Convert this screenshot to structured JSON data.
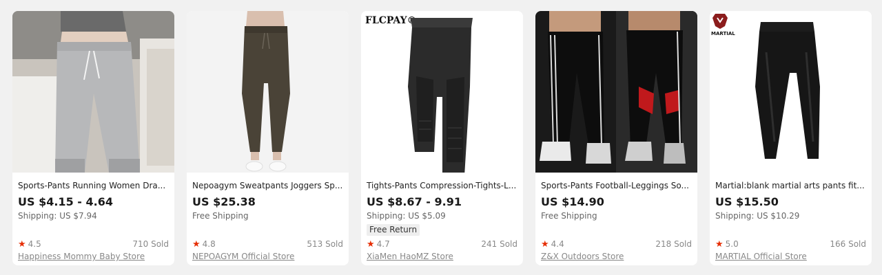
{
  "products": [
    {
      "title": "Sports-Pants Running Women Dra...",
      "price": "US $4.15 - 4.64",
      "shipping": "Shipping: US $7.94",
      "badge": "",
      "rating": "4.5",
      "sold": "710 Sold",
      "store": "Happiness Mommy Baby Store",
      "image_brand": ""
    },
    {
      "title": "Nepoagym Sweatpants Joggers Sp...",
      "price": "US $25.38",
      "shipping": "Free Shipping",
      "badge": "",
      "rating": "4.8",
      "sold": "513 Sold",
      "store": "NEPOAGYM Official Store",
      "image_brand": ""
    },
    {
      "title": "Tights-Pants Compression-Tights-L...",
      "price": "US $8.67 - 9.91",
      "shipping": "Shipping: US $5.09",
      "badge": "Free Return",
      "rating": "4.7",
      "sold": "241 Sold",
      "store": "XiaMen HaoMZ Store",
      "image_brand": "FLCPAY®"
    },
    {
      "title": "Sports-Pants Football-Leggings So...",
      "price": "US $14.90",
      "shipping": "Free Shipping",
      "badge": "",
      "rating": "4.4",
      "sold": "218 Sold",
      "store": "Z&X Outdoors Store",
      "image_brand": ""
    },
    {
      "title": "Martial:blank martial arts pants fit...",
      "price": "US $15.50",
      "shipping": "Shipping: US $10.29",
      "badge": "",
      "rating": "5.0",
      "sold": "166 Sold",
      "store": "MARTIAL Official Store",
      "image_brand": "MARTIAL"
    }
  ],
  "colors": {
    "page_bg": "#f1f1f1",
    "card_bg": "#ffffff",
    "star": "#e62e04",
    "muted_text": "#888888"
  },
  "icons": {
    "rating": "star-icon"
  }
}
